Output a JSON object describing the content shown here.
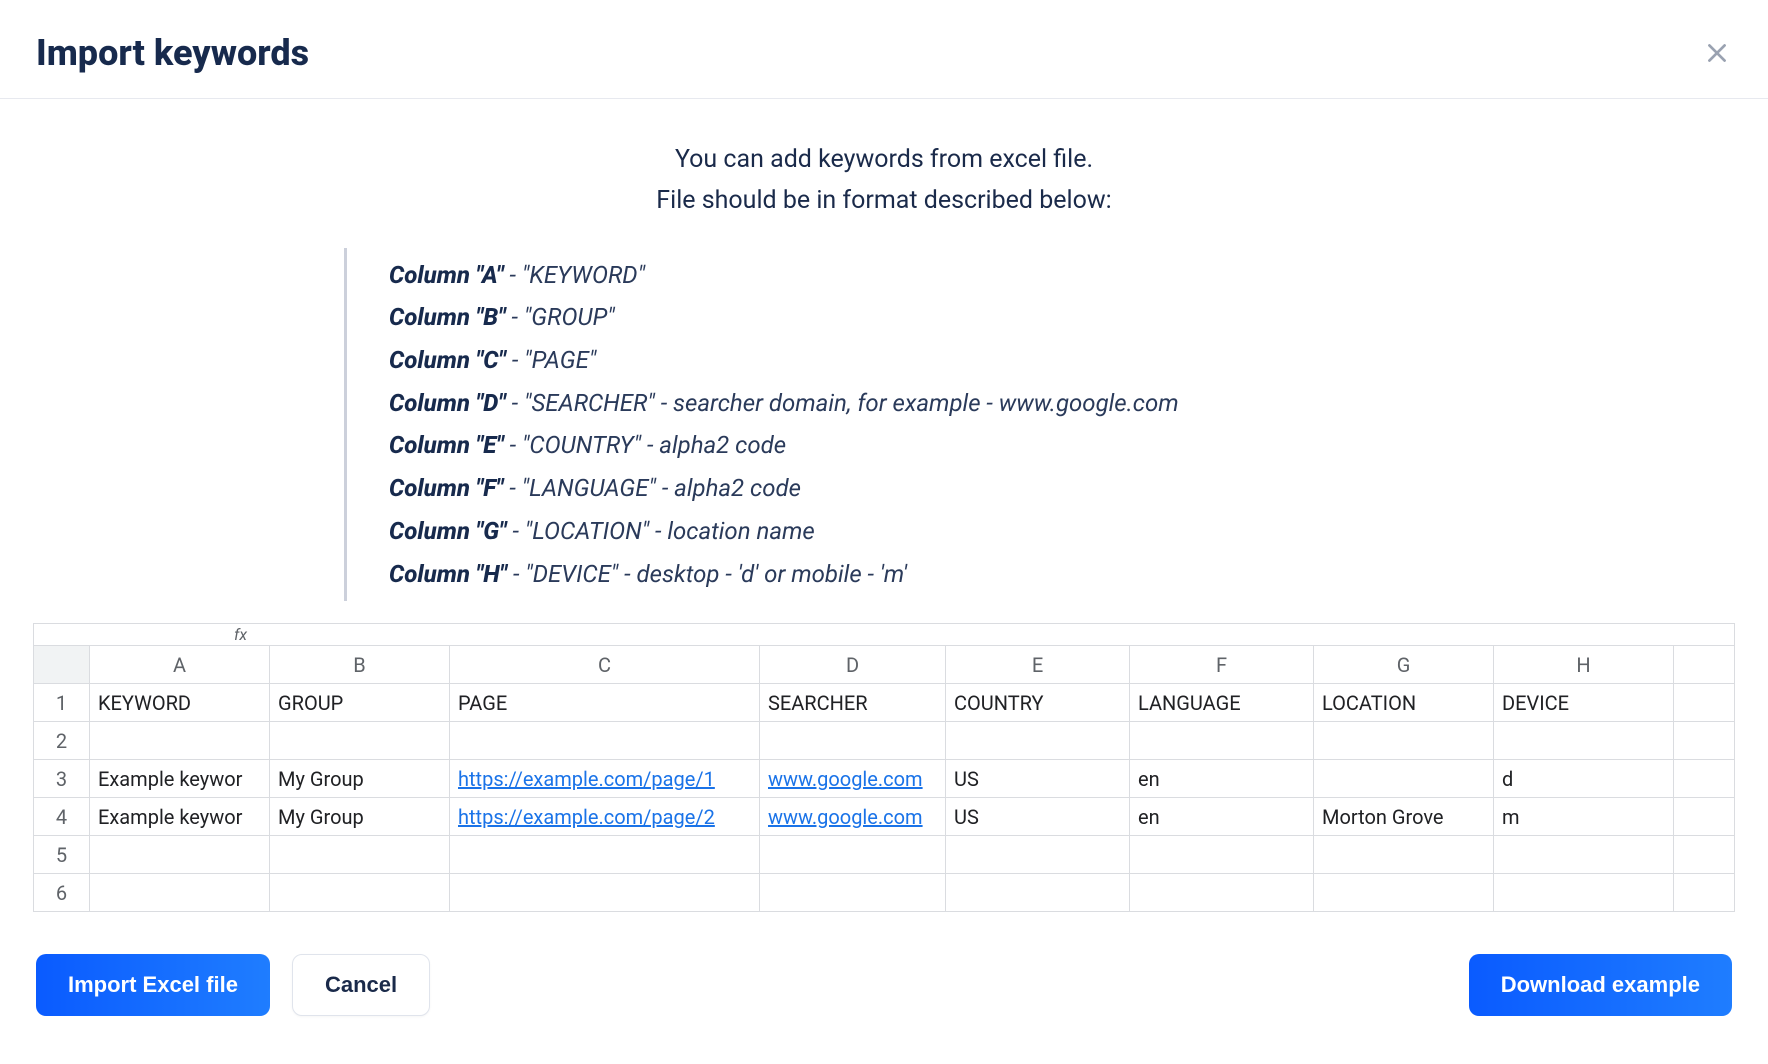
{
  "header": {
    "title": "Import keywords"
  },
  "intro": {
    "line1": "You can add keywords from excel file.",
    "line2": "File should be in format described below:"
  },
  "columns": [
    {
      "label": "Column \"A\"",
      "rest": " - \"KEYWORD\""
    },
    {
      "label": "Column \"B\"",
      "rest": " - \"GROUP\""
    },
    {
      "label": "Column \"C\"",
      "rest": " - \"PAGE\""
    },
    {
      "label": "Column \"D\"",
      "rest": " - \"SEARCHER\" - searcher domain, for example - www.google.com"
    },
    {
      "label": "Column \"E\"",
      "rest": " - \"COUNTRY\" - alpha2 code"
    },
    {
      "label": "Column \"F\"",
      "rest": " - \"LANGUAGE\" - alpha2 code"
    },
    {
      "label": "Column \"G\"",
      "rest": " - \"LOCATION\" - location name"
    },
    {
      "label": "Column \"H\"",
      "rest": " - \"DEVICE\" - desktop - 'd' or mobile - 'm'"
    }
  ],
  "sheet": {
    "fx": "fx",
    "colHeaders": [
      "A",
      "B",
      "C",
      "D",
      "E",
      "F",
      "G",
      "H"
    ],
    "rows": [
      {
        "num": "1",
        "cells": [
          "KEYWORD",
          "GROUP",
          "PAGE",
          "SEARCHER",
          "COUNTRY",
          "LANGUAGE",
          "LOCATION",
          "DEVICE"
        ],
        "links": [
          false,
          false,
          false,
          false,
          false,
          false,
          false,
          false
        ]
      },
      {
        "num": "2",
        "cells": [
          "",
          "",
          "",
          "",
          "",
          "",
          "",
          ""
        ],
        "links": [
          false,
          false,
          false,
          false,
          false,
          false,
          false,
          false
        ]
      },
      {
        "num": "3",
        "cells": [
          "Example keywor",
          "My Group",
          "https://example.com/page/1",
          "www.google.com",
          "US",
          "en",
          "",
          "d"
        ],
        "links": [
          false,
          false,
          true,
          true,
          false,
          false,
          false,
          false
        ]
      },
      {
        "num": "4",
        "cells": [
          "Example keywor",
          "My Group",
          "https://example.com/page/2",
          "www.google.com",
          "US",
          "en",
          "Morton Grove",
          "m"
        ],
        "links": [
          false,
          false,
          true,
          true,
          false,
          false,
          false,
          false
        ]
      },
      {
        "num": "5",
        "cells": [
          "",
          "",
          "",
          "",
          "",
          "",
          "",
          ""
        ],
        "links": [
          false,
          false,
          false,
          false,
          false,
          false,
          false,
          false
        ]
      },
      {
        "num": "6",
        "cells": [
          "",
          "",
          "",
          "",
          "",
          "",
          "",
          ""
        ],
        "links": [
          false,
          false,
          false,
          false,
          false,
          false,
          false,
          false
        ]
      }
    ]
  },
  "buttons": {
    "import": "Import Excel file",
    "cancel": "Cancel",
    "download": "Download example"
  }
}
